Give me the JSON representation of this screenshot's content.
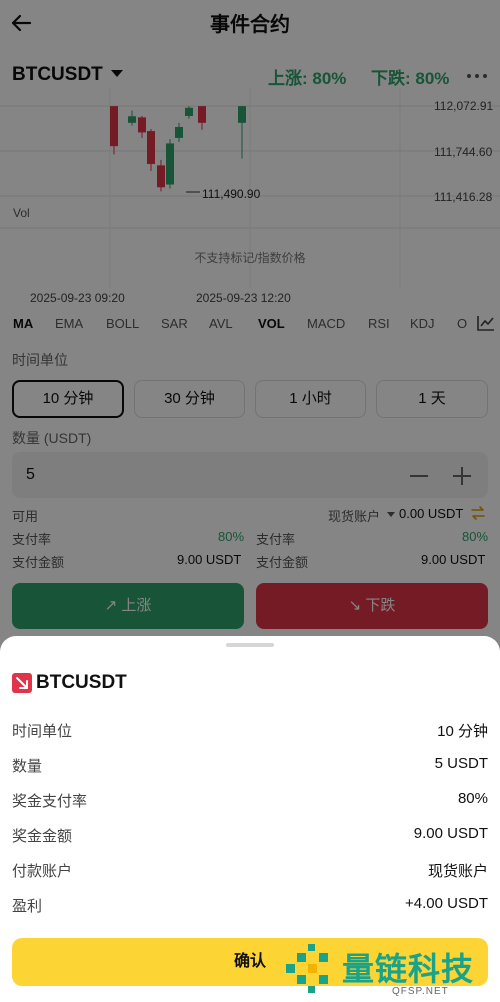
{
  "header": {
    "title": "事件合约"
  },
  "market": {
    "pair": "BTCUSDT",
    "rise_rate": "上涨: 80%",
    "fall_rate": "下跌: 80%"
  },
  "chart": {
    "price_ticks": [
      "112,072.91",
      "111,744.60",
      "111,416.28"
    ],
    "low_marker": "111,490.90",
    "vol_label": "Vol",
    "notice": "不支持标记/指数价格",
    "time_ticks": [
      "2025-09-23 09:20",
      "2025-09-23 12:20"
    ],
    "colors": {
      "up": "#2fa36b",
      "down": "#e0344a"
    }
  },
  "chart_data": {
    "type": "candlestick",
    "x": [
      "2025-09-23 09:20",
      "2025-09-23 12:20"
    ],
    "ylim": [
      111416.28,
      112072.91
    ],
    "candles": [
      {
        "open": 112072,
        "close": 111780,
        "high": 112072,
        "low": 111720,
        "dir": "down"
      },
      {
        "open": 111950,
        "close": 111998,
        "high": 112040,
        "low": 111930,
        "dir": "up"
      },
      {
        "open": 111990,
        "close": 111880,
        "high": 112000,
        "low": 111840,
        "dir": "down"
      },
      {
        "open": 111890,
        "close": 111650,
        "high": 111905,
        "low": 111600,
        "dir": "down"
      },
      {
        "open": 111640,
        "close": 111480,
        "high": 111680,
        "low": 111450,
        "dir": "down"
      },
      {
        "open": 111500,
        "close": 111800,
        "high": 111830,
        "low": 111470,
        "dir": "up"
      },
      {
        "open": 111840,
        "close": 111920,
        "high": 111950,
        "low": 111810,
        "dir": "up"
      },
      {
        "open": 112000,
        "close": 112060,
        "high": 112072,
        "low": 111980,
        "dir": "up"
      },
      {
        "open": 112072,
        "close": 111950,
        "high": 112072,
        "low": 111900,
        "dir": "down"
      },
      {
        "open": 111950,
        "close": 112072,
        "high": 112072,
        "low": 111690,
        "dir": "up"
      }
    ]
  },
  "indicators": {
    "tabs": [
      "MA",
      "EMA",
      "BOLL",
      "SAR",
      "AVL",
      "VOL",
      "MACD",
      "RSI",
      "KDJ",
      "O"
    ]
  },
  "time_unit": {
    "label": "时间单位",
    "options": [
      "10 分钟",
      "30 分钟",
      "1 小时",
      "1 天"
    ],
    "selected": "10 分钟"
  },
  "quantity": {
    "label": "数量 (USDT)",
    "value": "5"
  },
  "balance": {
    "available_label": "可用",
    "account": "现货账户",
    "amount": "0.00 USDT"
  },
  "rise_panel": {
    "pay_rate_label": "支付率",
    "pay_rate": "80%",
    "pay_amount_label": "支付金额",
    "pay_amount": "9.00 USDT"
  },
  "fall_panel": {
    "pay_rate_label": "支付率",
    "pay_rate": "80%",
    "pay_amount_label": "支付金额",
    "pay_amount": "9.00 USDT"
  },
  "actions": {
    "rise": "↗ 上涨",
    "fall": "↘ 下跌"
  },
  "sheet": {
    "title": "BTCUSDT",
    "rows": [
      {
        "label": "时间单位",
        "value": "10 分钟"
      },
      {
        "label": "数量",
        "value": "5 USDT"
      },
      {
        "label": "奖金支付率",
        "value": "80%"
      },
      {
        "label": "奖金金额",
        "value": "9.00 USDT"
      },
      {
        "label": "付款账户",
        "value": "现货账户"
      },
      {
        "label": "盈利",
        "value": "+4.00 USDT"
      }
    ],
    "confirm": "确认"
  },
  "watermark": {
    "text": "量链科技",
    "sub": "QFSP.NET"
  }
}
